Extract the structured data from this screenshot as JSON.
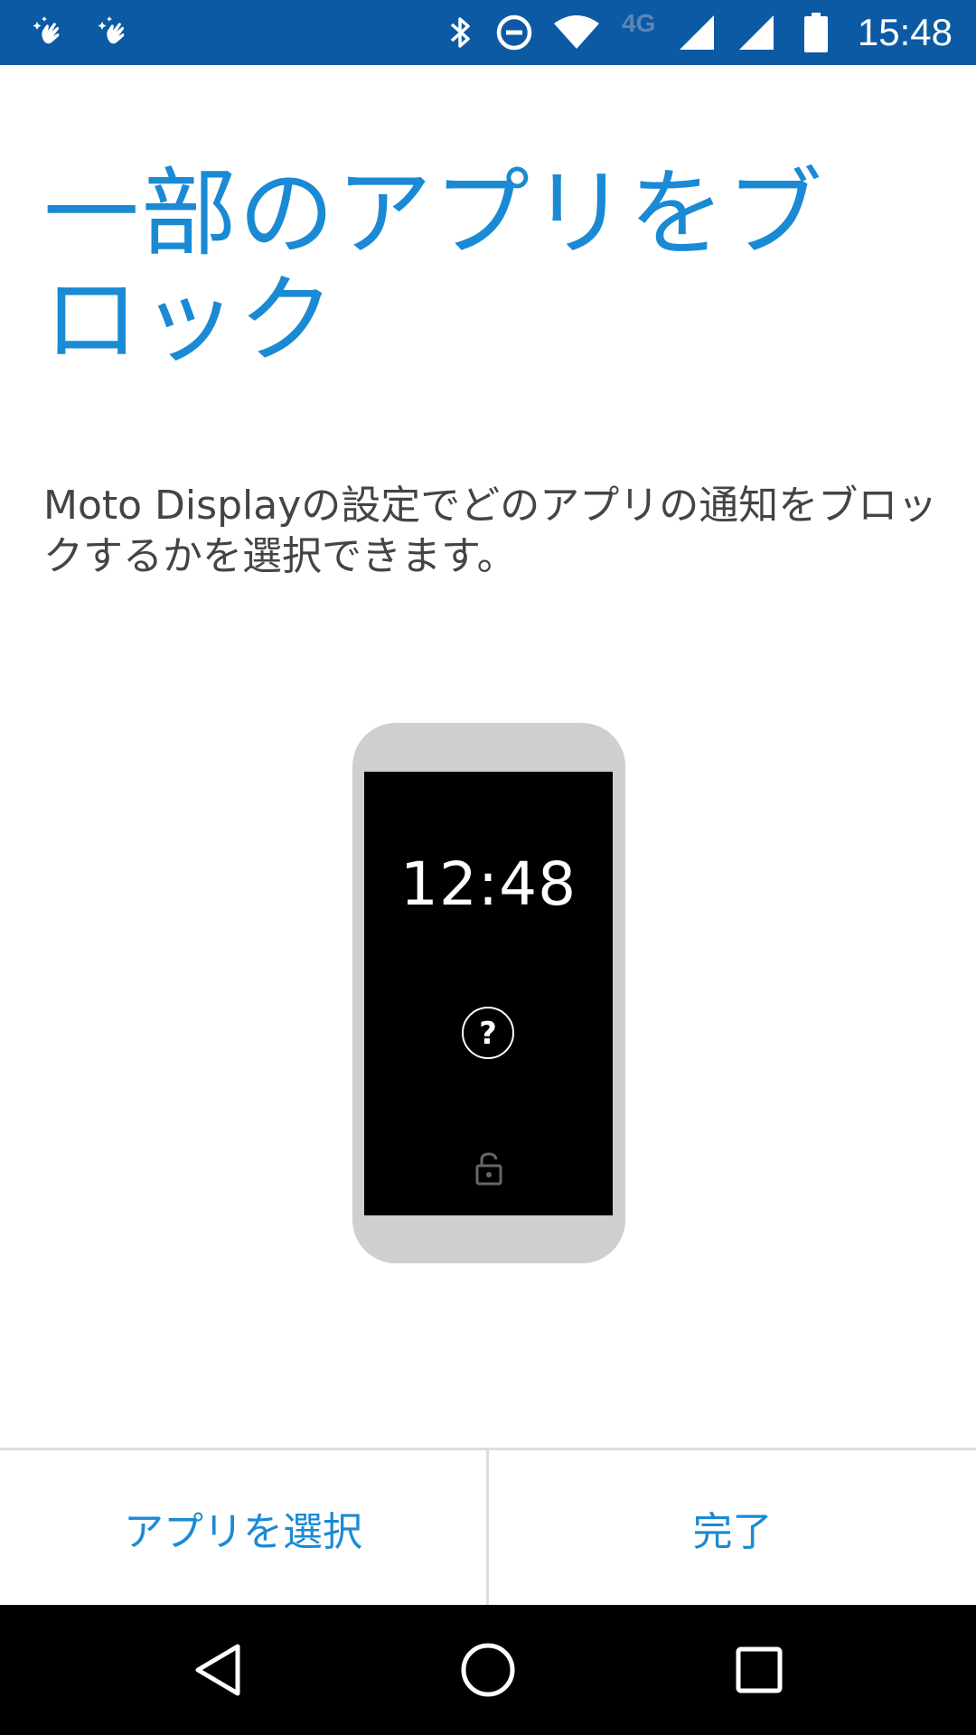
{
  "status_bar": {
    "time": "15:48",
    "network_label": "4G",
    "icons": [
      "hand-sparkle-icon",
      "hand-sparkle-icon",
      "bluetooth-icon",
      "do-not-disturb-icon",
      "wifi-icon",
      "signal-icon",
      "signal-icon",
      "battery-icon"
    ],
    "background_color": "#0b5aa3"
  },
  "page": {
    "title": "一部のアプリをブロック",
    "description": "Moto Displayの設定でどのアプリの通知をブロックするかを選択できます。",
    "accent_color": "#1a8ad4"
  },
  "illustration": {
    "clock": "12:48",
    "icons": [
      "question-icon",
      "lock-icon"
    ]
  },
  "actions": {
    "select_apps_label": "アプリを選択",
    "done_label": "完了"
  },
  "nav_bar": {
    "icons": [
      "back-icon",
      "home-icon",
      "recents-icon"
    ]
  }
}
